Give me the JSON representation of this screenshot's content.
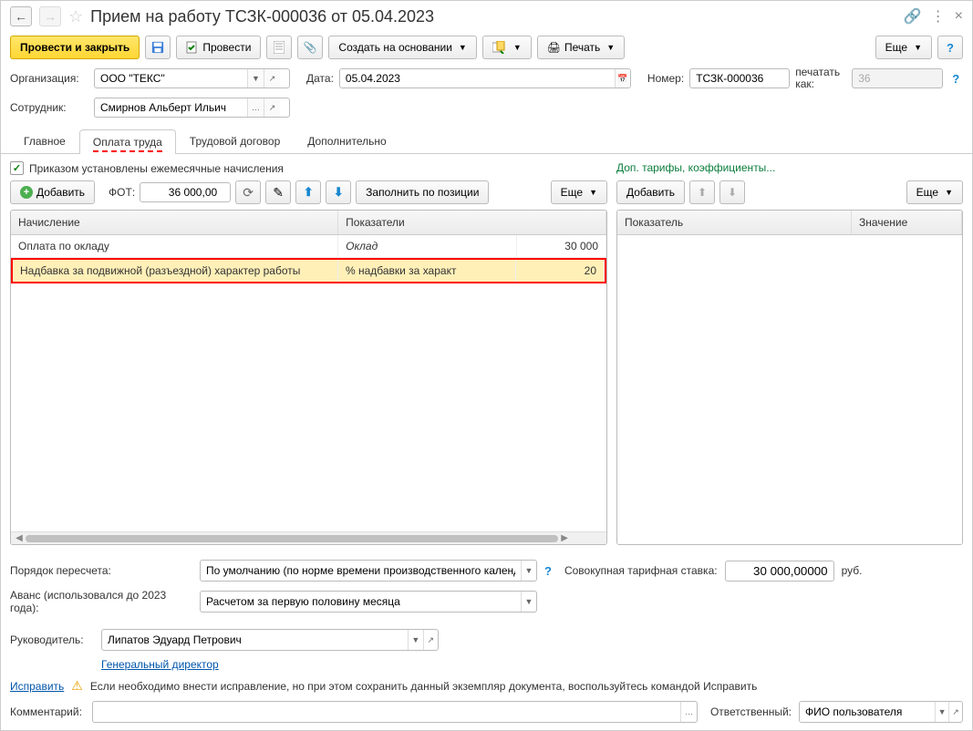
{
  "title": "Прием на работу ТСЗК-000036 от 05.04.2023",
  "toolbar": {
    "submit_close": "Провести и закрыть",
    "submit": "Провести",
    "create_based": "Создать на основании",
    "print": "Печать",
    "more": "Еще"
  },
  "header": {
    "org_label": "Организация:",
    "org_value": "ООО \"ТЕКС\"",
    "date_label": "Дата:",
    "date_value": "05.04.2023",
    "number_label": "Номер:",
    "number_value": "ТСЗК-000036",
    "print_as_label": "печатать как:",
    "print_as_value": "36",
    "employee_label": "Сотрудник:",
    "employee_value": "Смирнов Альберт Ильич"
  },
  "tabs": {
    "main": "Главное",
    "payment": "Оплата труда",
    "contract": "Трудовой договор",
    "additional": "Дополнительно"
  },
  "payment": {
    "checkbox_label": "Приказом установлены ежемесячные начисления",
    "tariffs_link": "Доп. тарифы, коэффициенты...",
    "add": "Добавить",
    "fot_label": "ФОТ:",
    "fot_value": "36 000,00",
    "fill_by_position": "Заполнить по позиции",
    "more": "Еще",
    "table1": {
      "col_accrual": "Начисление",
      "col_indicators": "Показатели",
      "rows": [
        {
          "accrual": "Оплата по окладу",
          "indicator": "Оклад",
          "value": "30 000"
        },
        {
          "accrual": "Надбавка за подвижной (разъездной) характер работы",
          "indicator": "% надбавки за характ",
          "value": "20"
        }
      ]
    },
    "table2": {
      "col_indicator": "Показатель",
      "col_value": "Значение"
    }
  },
  "recalc": {
    "order_label": "Порядок пересчета:",
    "order_value": "По умолчанию (по норме времени производственного календ",
    "rate_label": "Совокупная тарифная ставка:",
    "rate_value": "30 000,00000",
    "rate_unit": "руб.",
    "advance_label": "Аванс (использовался до 2023 года):",
    "advance_value": "Расчетом за первую половину месяца"
  },
  "footer": {
    "manager_label": "Руководитель:",
    "manager_value": "Липатов Эдуард Петрович",
    "manager_position": "Генеральный директор",
    "fix_link": "Исправить",
    "fix_text": "Если необходимо внести исправление, но при этом сохранить данный экземпляр документа, воспользуйтесь командой Исправить",
    "comment_label": "Комментарий:",
    "responsible_label": "Ответственный:",
    "responsible_value": "ФИО пользователя"
  }
}
